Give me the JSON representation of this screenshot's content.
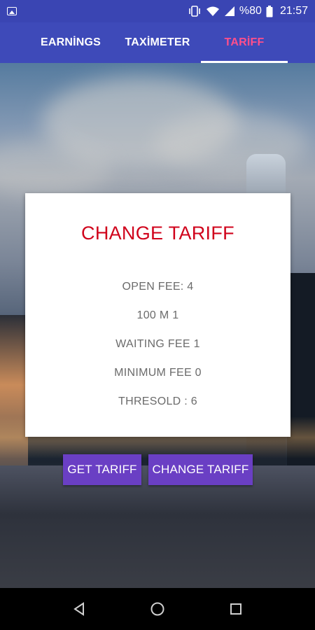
{
  "status_bar": {
    "battery_text": "%80",
    "time": "21:57",
    "icons": [
      "image-icon",
      "vibrate-icon",
      "wifi-icon",
      "signal-icon",
      "battery-icon"
    ]
  },
  "tabs": [
    {
      "label": "EARNİNGS",
      "active": false
    },
    {
      "label": "TAXİMETER",
      "active": false
    },
    {
      "label": "TARİFF",
      "active": true
    }
  ],
  "card": {
    "title": "CHANGE TARIFF",
    "rows": [
      "OPEN FEE: 4",
      "100 M 1",
      "WAITING FEE 1",
      "MINIMUM FEE 0",
      "THRESOLD : 6"
    ]
  },
  "buttons": {
    "get_tariff": "GET TARIFF",
    "change_tariff": "CHANGE TARIFF"
  },
  "nav_bar": {
    "icons": [
      "back-icon",
      "home-icon",
      "recents-icon"
    ]
  },
  "colors": {
    "app_bar": "#3e4ab9",
    "status_bar": "#3a45b3",
    "active_tab": "#ff4f8b",
    "card_title": "#d0021b",
    "button": "#6a3fc4"
  }
}
